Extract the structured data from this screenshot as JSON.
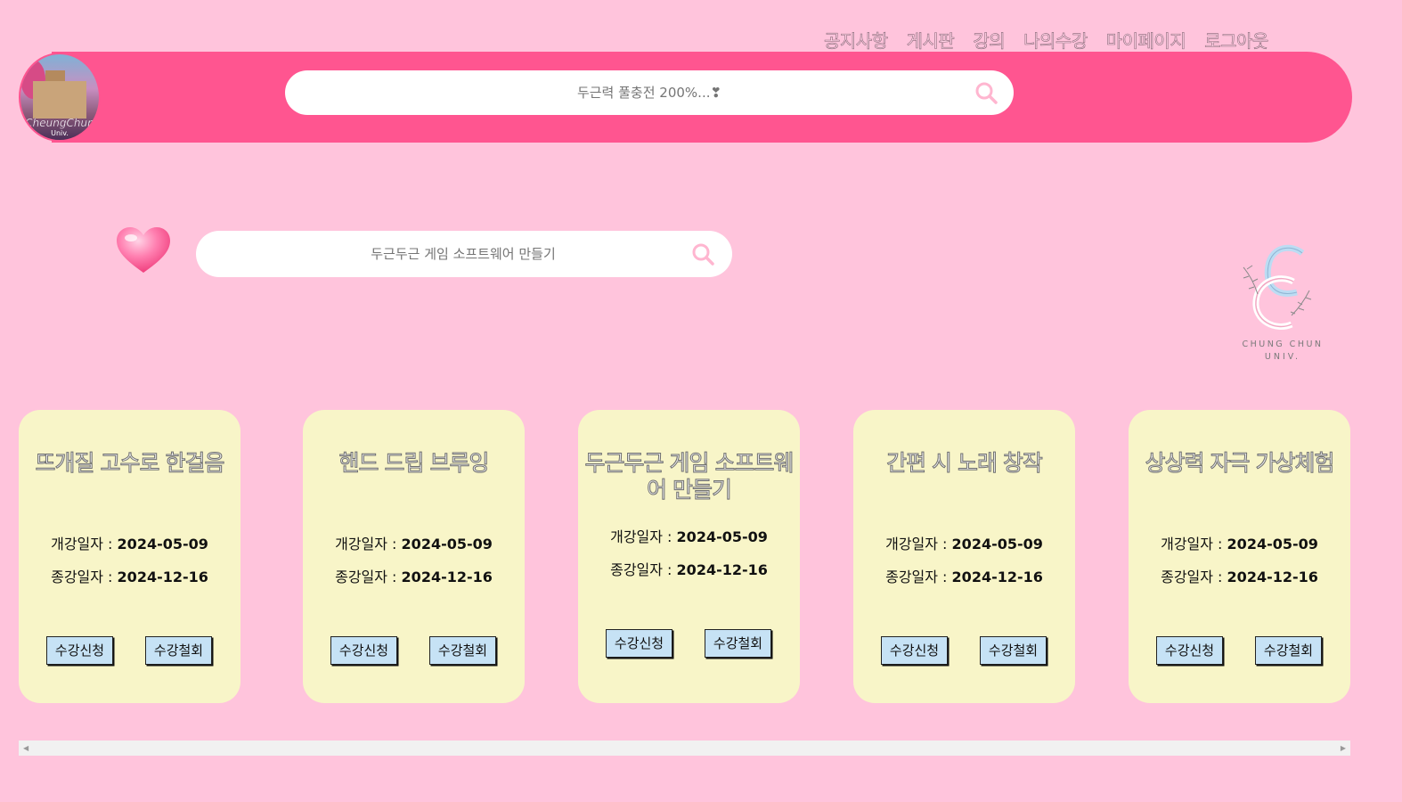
{
  "nav": {
    "items": [
      "공지사항",
      "게시판",
      "강의",
      "나의수강",
      "마이페이지",
      "로그아웃"
    ]
  },
  "header": {
    "logo_text": "CheungChun",
    "logo_sub": "Univ.",
    "search_placeholder": "두근력 풀충전 200%...❣"
  },
  "subsearch": {
    "placeholder": "두근두근 게임 소프트웨어 만들기"
  },
  "brand": {
    "line1": "CHUNG CHUN",
    "line2": "UNIV."
  },
  "courses": [
    {
      "title": "뜨개질 고수로 한걸음",
      "open_label": "개강일자 : ",
      "open_date": "2024-05-09",
      "close_label": "종강일자 : ",
      "close_date": "2024-12-16",
      "apply": "수강신청",
      "cancel": "수강철회"
    },
    {
      "title": "핸드 드립 브루잉",
      "open_label": "개강일자 : ",
      "open_date": "2024-05-09",
      "close_label": "종강일자 : ",
      "close_date": "2024-12-16",
      "apply": "수강신청",
      "cancel": "수강철회"
    },
    {
      "title": "두근두근 게임 소프트웨어 만들기",
      "open_label": "개강일자 : ",
      "open_date": "2024-05-09",
      "close_label": "종강일자 : ",
      "close_date": "2024-12-16",
      "apply": "수강신청",
      "cancel": "수강철회"
    },
    {
      "title": "간편 시 노래 창작",
      "open_label": "개강일자 : ",
      "open_date": "2024-05-09",
      "close_label": "종강일자 : ",
      "close_date": "2024-12-16",
      "apply": "수강신청",
      "cancel": "수강철회"
    },
    {
      "title": "상상력 자극 가상체험",
      "open_label": "개강일자 : ",
      "open_date": "2024-05-09",
      "close_label": "종강일자 : ",
      "close_date": "2024-12-16",
      "apply": "수강신청",
      "cancel": "수강철회"
    }
  ],
  "colors": {
    "background": "#ffc4dc",
    "header": "#ff5590",
    "card": "#f8f5c8",
    "button": "#c6e2f5",
    "search_icon": "#ffb6d0"
  },
  "icons": {
    "search": "search-icon",
    "heart": "heart-icon"
  }
}
